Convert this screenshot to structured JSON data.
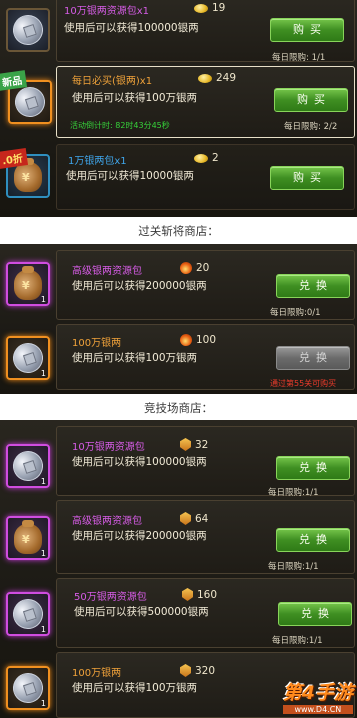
{
  "shop1": {
    "items": [
      {
        "title": "10万银两资源包x1",
        "price": "19",
        "desc": "使用后可以获得100000银两",
        "button": "购买",
        "limit": "每日限购: 1/1"
      },
      {
        "title": "每日必买(银两)x1",
        "price": "249",
        "desc": "使用后可以获得100万银两",
        "button": "购买",
        "countdown": "活动倒计时: 82时43分45秒",
        "limit": "每日限购: 2/2",
        "badge": "新品"
      },
      {
        "title": "1万银两包x1",
        "price": "2",
        "desc": "使用后可以获得10000银两",
        "button": "购买",
        "badge": ".0折"
      }
    ]
  },
  "shop2": {
    "header": "过关斩将商店：",
    "items": [
      {
        "title": "高级银两资源包",
        "price": "20",
        "desc": "使用后可以获得200000银两",
        "button": "兑换",
        "limit": "每日限购:0/1",
        "count": "1"
      },
      {
        "title": "100万银两",
        "price": "100",
        "desc": "使用后可以获得100万银两",
        "button": "兑换",
        "note": "通过第55关可购买",
        "count": "1"
      }
    ]
  },
  "shop3": {
    "header": "竞技场商店：",
    "items": [
      {
        "title": "10万银两资源包",
        "price": "32",
        "desc": "使用后可以获得100000银两",
        "button": "兑换",
        "limit": "每日限购:1/1",
        "count": "1"
      },
      {
        "title": "高级银两资源包",
        "price": "64",
        "desc": "使用后可以获得200000银两",
        "button": "兑换",
        "limit": "每日限购:1/1",
        "count": "1"
      },
      {
        "title": "50万银两资源包",
        "price": "160",
        "desc": "使用后可以获得500000银两",
        "button": "兑换",
        "limit": "每日限购:1/1",
        "count": "1"
      },
      {
        "title": "100万银两",
        "price": "320",
        "desc": "使用后可以获得100万银两",
        "button": "兑换",
        "count": "1"
      }
    ]
  },
  "watermark": {
    "main": "第4手游",
    "sub": "www.D4.CN"
  },
  "colors": {
    "button_green": "#3f8f22",
    "title_purple": "#d65ce6",
    "title_orange": "#f0a23a",
    "title_blue": "#3fa5ea",
    "note_red": "#ea3b2b"
  }
}
